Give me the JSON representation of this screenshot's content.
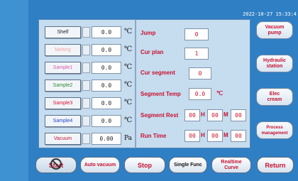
{
  "status": {
    "datetime": "2022-10-27 15:33:4"
  },
  "sensors": [
    {
      "label": "Shelf",
      "label_color": "#222222",
      "value": "0.0",
      "unit": "℃"
    },
    {
      "label": "Melting",
      "label_color": "#f0a89e",
      "value": "0.0",
      "unit": "℃"
    },
    {
      "label": "Sample1",
      "label_color": "#d65aa8",
      "value": "0.0",
      "unit": "℃"
    },
    {
      "label": "Sample2",
      "label_color": "#2e8a2e",
      "value": "0.0",
      "unit": "℃"
    },
    {
      "label": "Sample3",
      "label_color": "#d8102a",
      "value": "0.0",
      "unit": "℃"
    },
    {
      "label": "Sample4",
      "label_color": "#1e44c8",
      "value": "0.0",
      "unit": "℃"
    },
    {
      "label": "Vacuum",
      "label_color": "#c8102e",
      "value": "0.00",
      "unit": "Pa"
    }
  ],
  "process": {
    "jump_label": "Jump",
    "jump_value": "0",
    "cur_plan_label": "Cur plan",
    "cur_plan_value": "1",
    "cur_segment_label": "Cur segment",
    "cur_segment_value": "0",
    "segment_temp_label": "Segment Temp",
    "segment_temp_value": "0.0",
    "segment_temp_unit": "℃",
    "segment_rest_label": "Segment Rest",
    "segment_rest_h": "00",
    "segment_rest_m": "00",
    "segment_rest_s": "00",
    "run_time_label": "Run Time",
    "run_time_h": "00",
    "run_time_m": "00",
    "run_time_s": "00",
    "hour_unit": "H",
    "minute_unit": "M"
  },
  "side_buttons": {
    "vacuum_pump": "Vacuum\npump",
    "hydraulic_station": "Hydraulic\nstation",
    "elec_cream": "Elec\ncream",
    "process_management": "Process\nmanagement"
  },
  "bottom_buttons": {
    "start": "Start",
    "auto_vacuum": "Auto vacuum",
    "stop": "Stop",
    "single_func": "Single Func",
    "realtime_curve": "Realtime\nCurve",
    "return": "Return"
  },
  "icons": {
    "start_disabled": "no-entry-icon"
  },
  "colors": {
    "accent_red": "#c8102e",
    "background_blue": "#2f7fc4",
    "panel": "#c6dcef"
  }
}
